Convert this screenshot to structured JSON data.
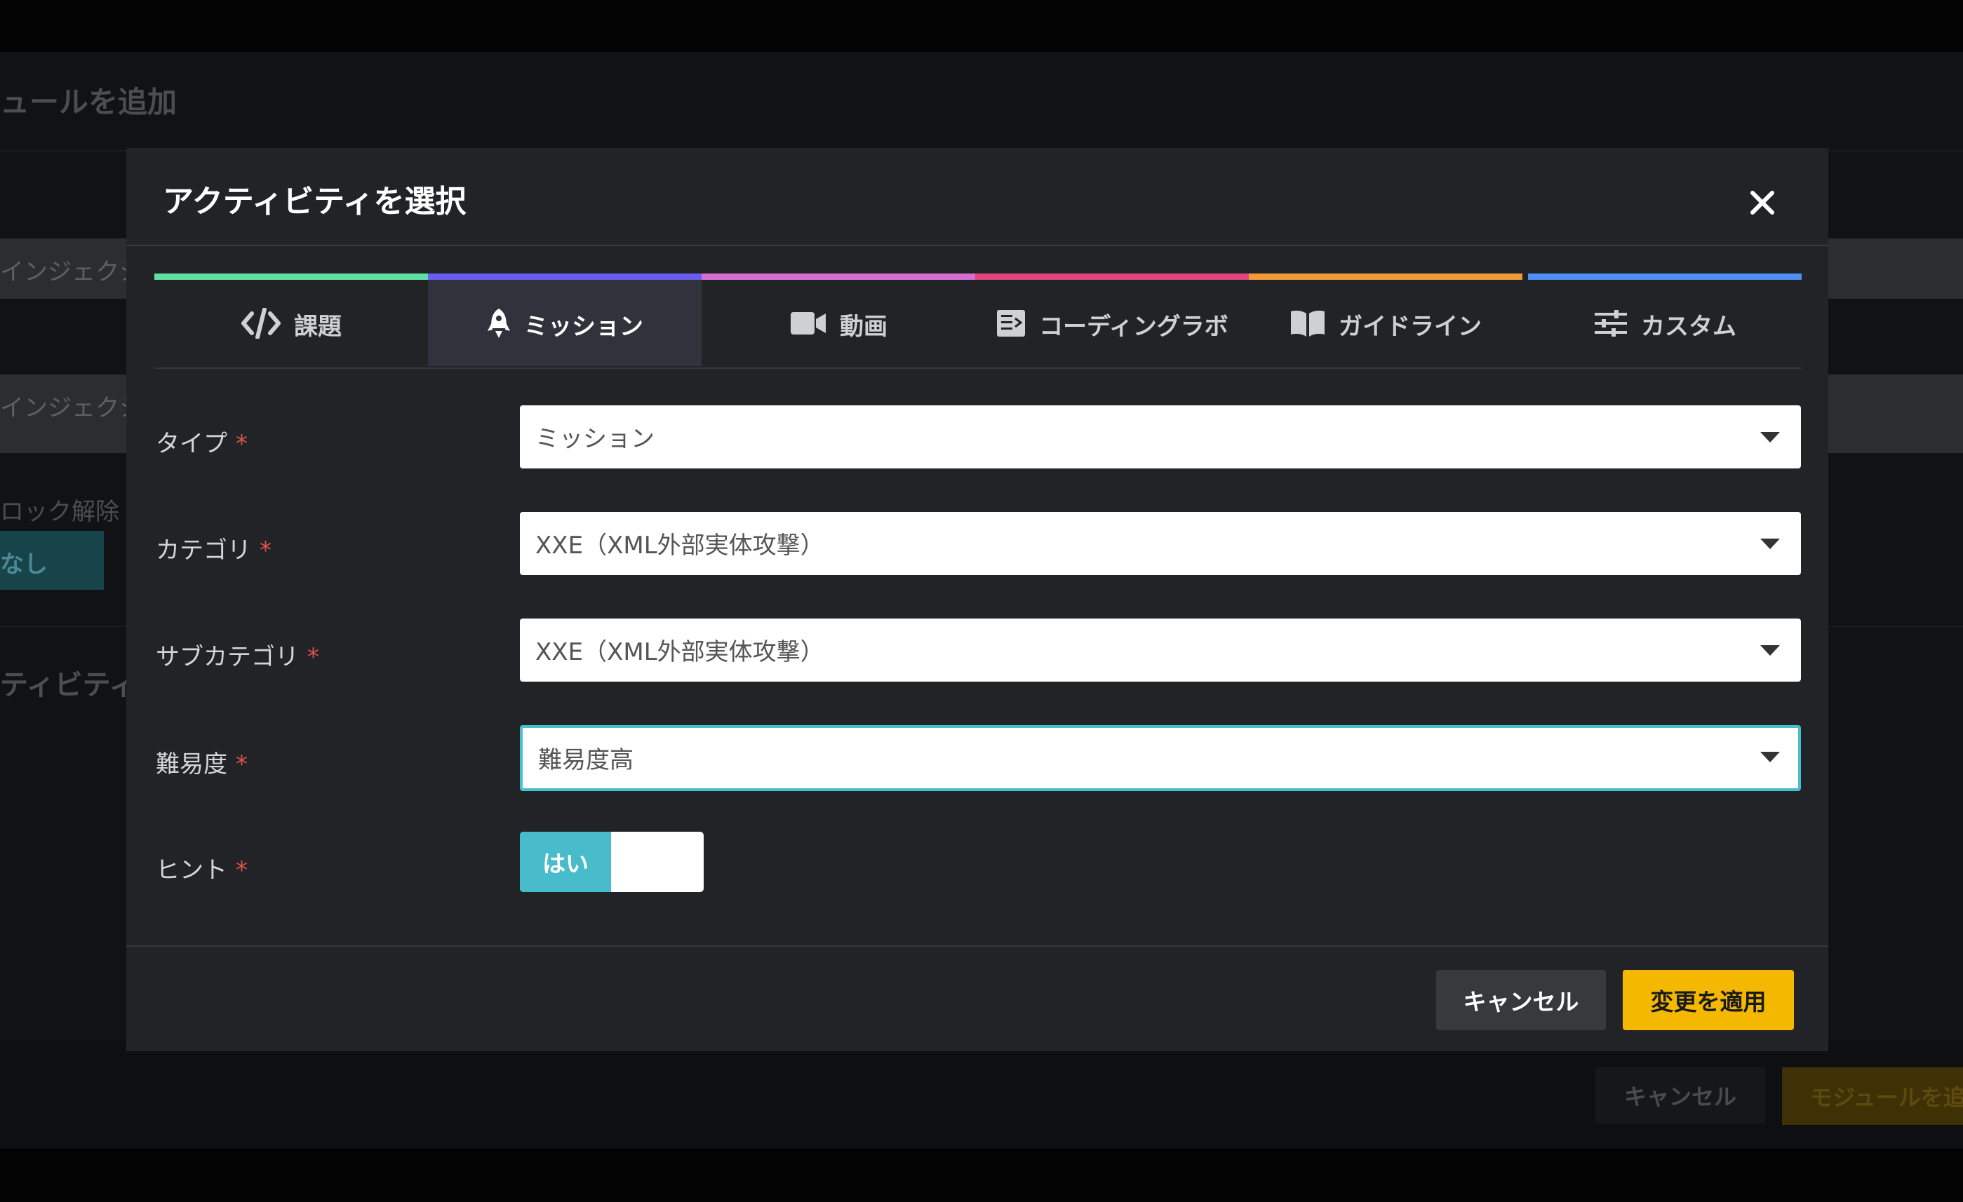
{
  "background": {
    "page_title": "ュールを追加",
    "row1_text": "インジェクシ",
    "row2_text": "インジェクシ",
    "unlock_label": "ロック解除",
    "unlock_value": "なし",
    "section_label": "ティビティ",
    "cancel_label": "キャンセル",
    "add_label": "モジュールを追"
  },
  "modal": {
    "title": "アクティビティを選択",
    "tabs": [
      {
        "label": "課題",
        "icon": "code-icon",
        "color": "#5fe0a0"
      },
      {
        "label": "ミッション",
        "icon": "rocket-icon",
        "color": "#6b5cf0"
      },
      {
        "label": "動画",
        "icon": "video-camera-icon",
        "color": "#d46fd0"
      },
      {
        "label": "コーディングラボ",
        "icon": "terminal-icon",
        "color": "#e0457e"
      },
      {
        "label": "ガイドライン",
        "icon": "book-icon",
        "color": "#f09a3a"
      },
      {
        "label": "カスタム",
        "icon": "sliders-icon",
        "color": "#4f8ef2"
      }
    ],
    "active_tab": "ミッション",
    "fields": {
      "type": {
        "label": "タイプ",
        "value": "ミッション"
      },
      "category": {
        "label": "カテゴリ",
        "value": "XXE（XML外部実体攻撃）"
      },
      "subcategory": {
        "label": "サブカテゴリ",
        "value": "XXE（XML外部実体攻撃）"
      },
      "difficulty": {
        "label": "難易度",
        "value": "難易度高"
      },
      "hint": {
        "label": "ヒント",
        "toggle_label": "はい"
      }
    },
    "required_mark": "*",
    "cancel_label": "キャンセル",
    "apply_label": "変更を適用"
  }
}
